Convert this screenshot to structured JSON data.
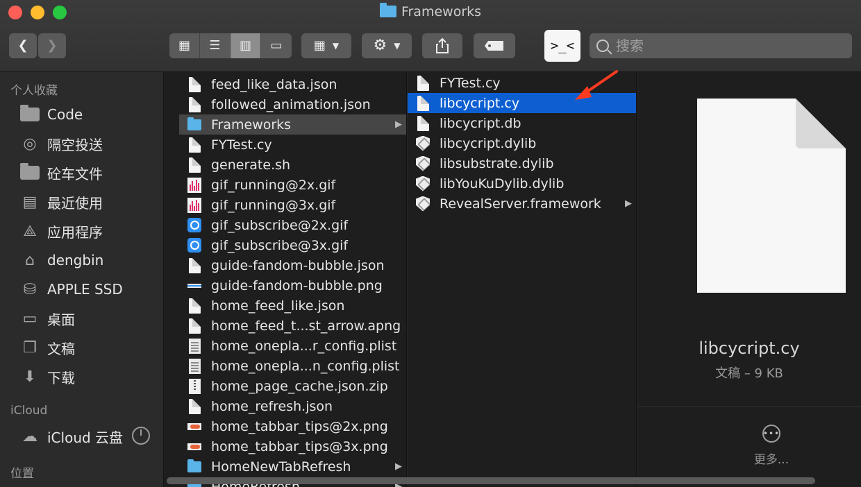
{
  "window": {
    "title": "Frameworks"
  },
  "toolbar": {
    "back_icon": "chevron-left",
    "forward_icon": "chevron-right",
    "view_modes": [
      "icons",
      "list",
      "columns",
      "gallery"
    ],
    "active_view": "columns",
    "group_icon": "group-grid",
    "action_icon": "gear",
    "share_icon": "share",
    "tag_icon": "tag",
    "cycript_label": ">_<",
    "search_placeholder": "搜索"
  },
  "sidebar": {
    "favorites_header": "个人收藏",
    "favorites": [
      {
        "label": "Code",
        "icon": "folder"
      },
      {
        "label": "隔空投送",
        "icon": "airdrop"
      },
      {
        "label": "砼车文件",
        "icon": "folder"
      },
      {
        "label": "最近使用",
        "icon": "recents"
      },
      {
        "label": "应用程序",
        "icon": "applications"
      },
      {
        "label": "dengbin",
        "icon": "home"
      },
      {
        "label": "APPLE SSD",
        "icon": "disk"
      },
      {
        "label": "桌面",
        "icon": "desktop"
      },
      {
        "label": "文稿",
        "icon": "documents"
      },
      {
        "label": "下载",
        "icon": "downloads"
      }
    ],
    "icloud_header": "iCloud",
    "icloud_items": [
      {
        "label": "iCloud 云盘",
        "icon": "cloud"
      }
    ],
    "locations_header": "位置"
  },
  "column1": {
    "items": [
      {
        "name": "feed_like_data.json",
        "icon": "doc"
      },
      {
        "name": "followed_animation.json",
        "icon": "doc"
      },
      {
        "name": "Frameworks",
        "icon": "folder",
        "selected": true,
        "has_children": true
      },
      {
        "name": "FYTest.cy",
        "icon": "doc"
      },
      {
        "name": "generate.sh",
        "icon": "doc"
      },
      {
        "name": "gif_running@2x.gif",
        "icon": "gif"
      },
      {
        "name": "gif_running@3x.gif",
        "icon": "gif"
      },
      {
        "name": "gif_subscribe@2x.gif",
        "icon": "alarm"
      },
      {
        "name": "gif_subscribe@3x.gif",
        "icon": "alarm"
      },
      {
        "name": "guide-fandom-bubble.json",
        "icon": "doc"
      },
      {
        "name": "guide-fandom-bubble.png",
        "icon": "pngbar"
      },
      {
        "name": "home_feed_like.json",
        "icon": "doc"
      },
      {
        "name": "home_feed_t...st_arrow.apng",
        "icon": "doc"
      },
      {
        "name": "home_onepla...r_config.plist",
        "icon": "plist"
      },
      {
        "name": "home_onepla...n_config.plist",
        "icon": "plist"
      },
      {
        "name": "home_page_cache.json.zip",
        "icon": "zip"
      },
      {
        "name": "home_refresh.json",
        "icon": "doc"
      },
      {
        "name": "home_tabbar_tips@2x.png",
        "icon": "tabpng"
      },
      {
        "name": "home_tabbar_tips@3x.png",
        "icon": "tabpng"
      },
      {
        "name": "HomeNewTabRefresh",
        "icon": "folder",
        "has_children": true
      },
      {
        "name": "HomeRefresh",
        "icon": "folder",
        "has_children": true
      }
    ]
  },
  "column2": {
    "items": [
      {
        "name": "FYTest.cy",
        "icon": "doc"
      },
      {
        "name": "libcycript.cy",
        "icon": "doc",
        "selected": true
      },
      {
        "name": "libcycript.db",
        "icon": "doc"
      },
      {
        "name": "libcycript.dylib",
        "icon": "shield"
      },
      {
        "name": "libsubstrate.dylib",
        "icon": "shield"
      },
      {
        "name": "libYouKuDylib.dylib",
        "icon": "shield"
      },
      {
        "name": "RevealServer.framework",
        "icon": "shield",
        "has_children": true
      }
    ]
  },
  "preview": {
    "file_name": "libcycript.cy",
    "file_info": "文稿 – 9 KB",
    "more_label": "更多..."
  },
  "colors": {
    "selection_blue": "#0d5fd1",
    "folder_blue": "#5ab4ea",
    "annotation_arrow": "#ff3b1f"
  }
}
